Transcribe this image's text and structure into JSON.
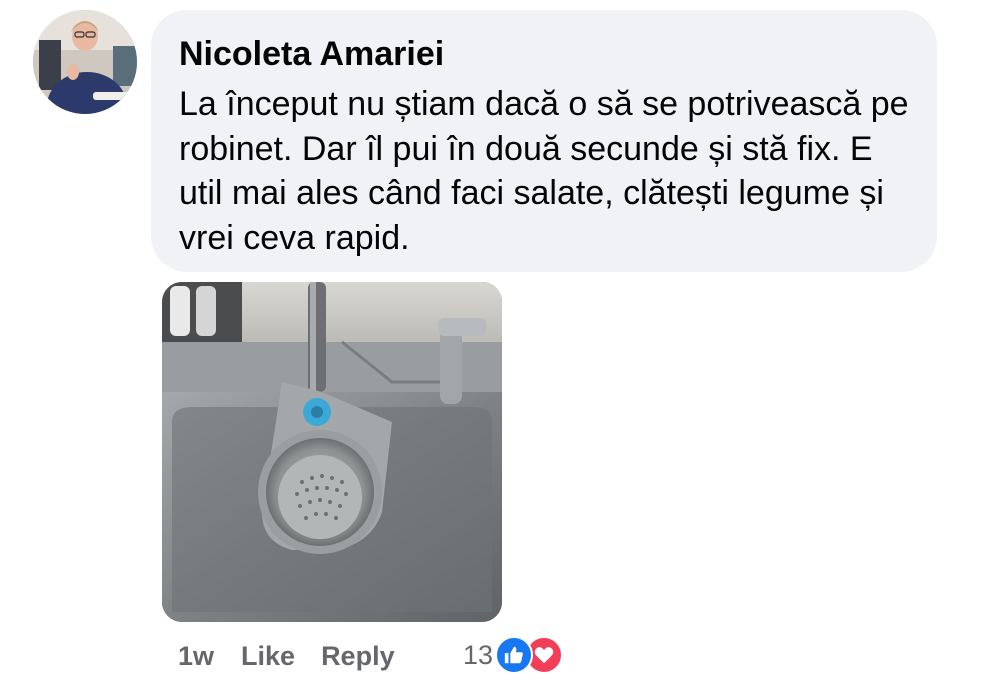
{
  "comment": {
    "author": "Nicoleta Amariei",
    "text": "La început nu știam dacă o să se potrivească pe robinet. Dar îl pui în două secunde și stă fix. E util mai ales când faci salate, clătești legume și vrei ceva rapid.",
    "time": "1w",
    "like_label": "Like",
    "reply_label": "Reply",
    "reaction_count": "13",
    "reactions": [
      "like-icon",
      "love-icon"
    ]
  },
  "colors": {
    "bubble_bg": "#f0f2f5",
    "meta_text": "#65676b",
    "like_blue": "#1877f2",
    "love_red": "#f33e58"
  }
}
